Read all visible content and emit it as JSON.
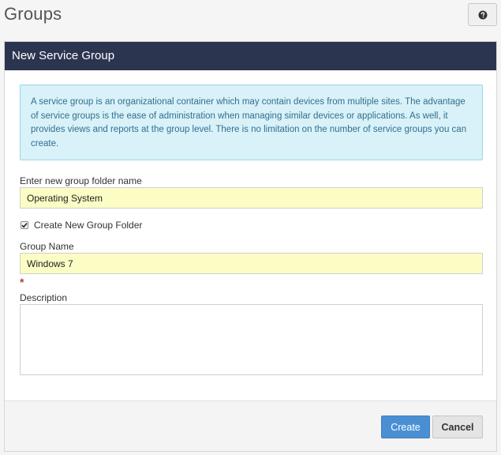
{
  "page": {
    "title": "Groups"
  },
  "help": {
    "icon": "question-circle-icon"
  },
  "panel": {
    "title": "New Service Group",
    "info_text": "A service group is an organizational container which may contain devices from multiple sites. The advantage of service groups is the ease of administration when managing similar devices or applications. As well, it provides views and reports at the group level. There is no limitation on the number of service groups you can create."
  },
  "form": {
    "folder_label": "Enter new group folder name",
    "folder_value": "Operating System",
    "create_folder_label": "Create New Group Folder",
    "create_folder_checked": true,
    "group_name_label": "Group Name",
    "group_name_value": "Windows 7",
    "required_marker": "*",
    "description_label": "Description",
    "description_value": ""
  },
  "footer": {
    "create_label": "Create",
    "cancel_label": "Cancel"
  },
  "colors": {
    "header_bg": "#2c3550",
    "info_bg": "#d9f1f8",
    "input_highlight": "#fcfcc5",
    "primary_button": "#4a8fd4"
  }
}
